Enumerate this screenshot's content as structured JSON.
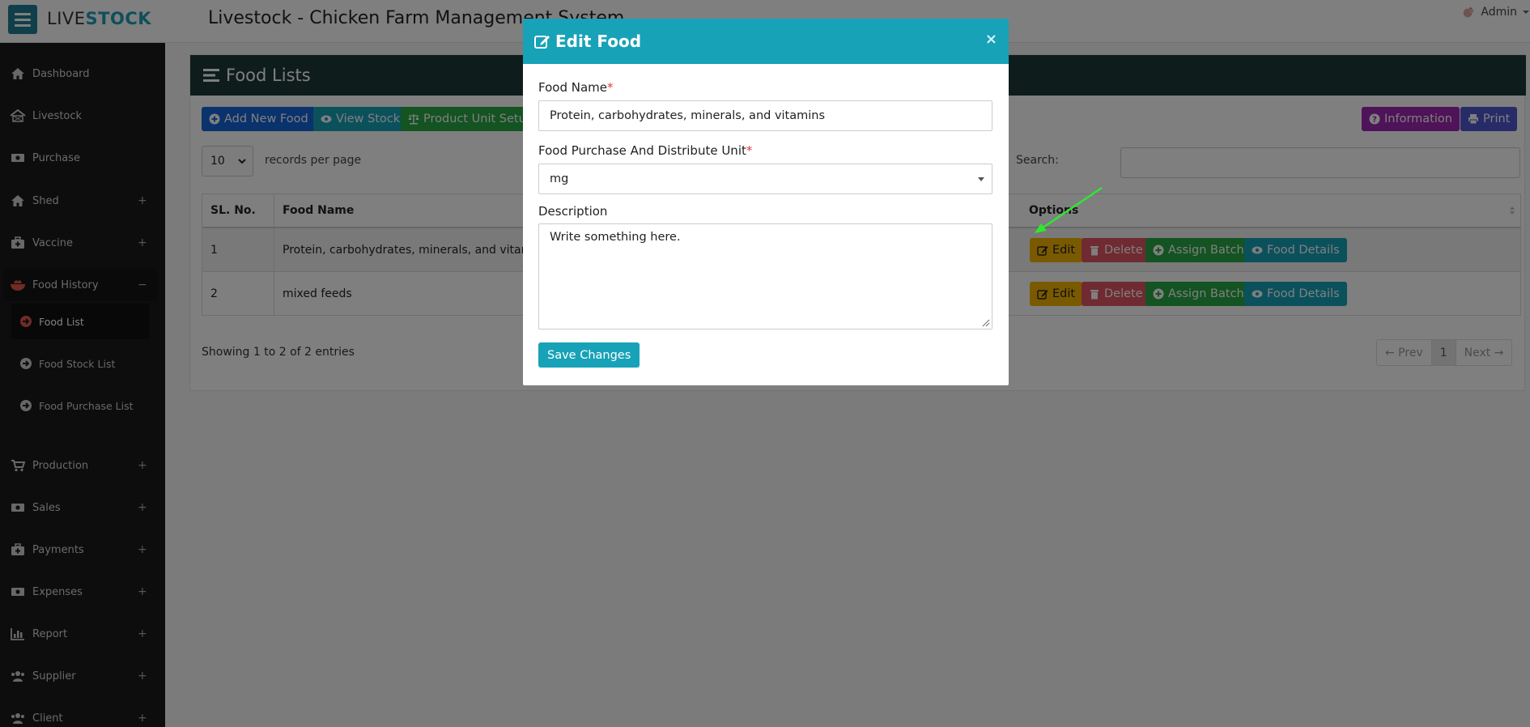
{
  "topbar": {
    "brand_part1": "LIVE",
    "brand_part2": "STOCK",
    "title": "Livestock - Chicken Farm Management System",
    "user_name": "Admin"
  },
  "sidebar": {
    "items": [
      {
        "label": "Dashboard",
        "icon": "home-icon",
        "expandable": false
      },
      {
        "label": "Livestock",
        "icon": "barn-icon",
        "expandable": false
      },
      {
        "label": "Purchase",
        "icon": "money-icon",
        "expandable": false
      },
      {
        "label": "Shed",
        "icon": "home-icon",
        "expandable": true
      },
      {
        "label": "Vaccine",
        "icon": "medkit-icon",
        "expandable": true
      },
      {
        "label": "Food History",
        "icon": "bowl-icon",
        "expandable": true,
        "expanded": true
      },
      {
        "label": "Production",
        "icon": "cart-icon",
        "expandable": true
      },
      {
        "label": "Sales",
        "icon": "money-icon",
        "expandable": true
      },
      {
        "label": "Payments",
        "icon": "medkit-icon",
        "expandable": true
      },
      {
        "label": "Expenses",
        "icon": "money-icon",
        "expandable": true
      },
      {
        "label": "Report",
        "icon": "bar-chart-icon",
        "expandable": true
      },
      {
        "label": "Supplier",
        "icon": "users-icon",
        "expandable": true
      },
      {
        "label": "Client",
        "icon": "users-icon",
        "expandable": true
      }
    ],
    "expand_symbol": "+",
    "collapse_symbol": "−",
    "sub_items": [
      {
        "label": "Food List",
        "active": true
      },
      {
        "label": "Food Stock List",
        "active": false
      },
      {
        "label": "Food Purchase List",
        "active": false
      }
    ]
  },
  "page": {
    "card_title": "Food Lists",
    "buttons": {
      "add_new_food": "Add New Food",
      "view_stock": "View Stock",
      "product_unit_setup": "Product Unit Setup",
      "information": "Information",
      "print": "Print"
    },
    "per_page_value": "10",
    "per_page_label": "records per page",
    "search_label": "Search:",
    "table": {
      "headers": [
        "SL. No.",
        "Food Name",
        "Options"
      ],
      "rows": [
        {
          "sl": "1",
          "name": "Protein, carbohydrates, minerals, and vitamins"
        },
        {
          "sl": "2",
          "name": "mixed feeds"
        }
      ],
      "row_actions": {
        "edit": "Edit",
        "delete": "Delete",
        "assign_batch": "Assign Batch",
        "food_details": "Food Details"
      }
    },
    "showing_text": "Showing 1 to 2 of 2 entries",
    "pagination": {
      "prev": "← Prev",
      "current": "1",
      "next": "Next →"
    }
  },
  "modal": {
    "title": "Edit Food",
    "close_symbol": "×",
    "food_name_label": "Food Name",
    "required_mark": "*",
    "food_name_value": "Protein, carbohydrates, minerals, and vitamins",
    "unit_label": "Food Purchase And Distribute Unit",
    "unit_value": "mg",
    "description_label": "Description",
    "description_placeholder": "Write something here.",
    "save_label": "Save Changes"
  },
  "colors": {
    "brand_teal": "#17a2b8",
    "sidebar_bg": "#1b1b1b",
    "card_header_bg": "#1d3a36",
    "annotation_arrow": "#2ee82e"
  }
}
